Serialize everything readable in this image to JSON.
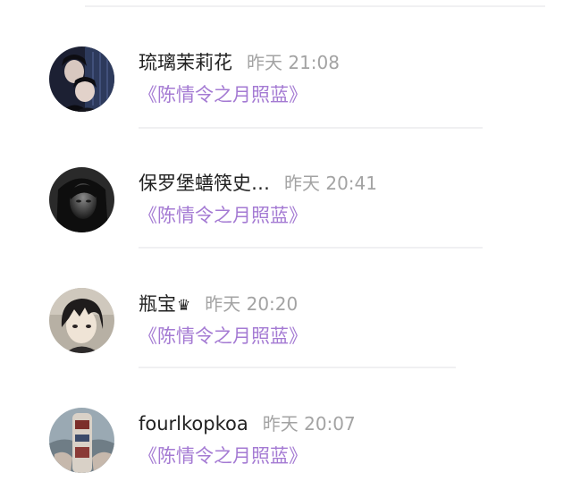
{
  "items": [
    {
      "name": "琉璃茉莉花",
      "crown": "",
      "time": "昨天 21:08",
      "work": "《陈情令之月照蓝》"
    },
    {
      "name": "保罗堡蟮筷史…",
      "crown": "",
      "time": "昨天 20:41",
      "work": "《陈情令之月照蓝》"
    },
    {
      "name": "瓶宝",
      "crown": "♛",
      "time": "昨天 20:20",
      "work": "《陈情令之月照蓝》"
    },
    {
      "name": "fourlkopkoa",
      "crown": "",
      "time": "昨天 20:07",
      "work": "《陈情令之月照蓝》"
    }
  ],
  "colors": {
    "name": "#222222",
    "time": "#a3a3a3",
    "link": "#a47ad3",
    "divider": "#f0f0f2"
  },
  "icons": [
    "avatar-image",
    "crown-icon"
  ]
}
